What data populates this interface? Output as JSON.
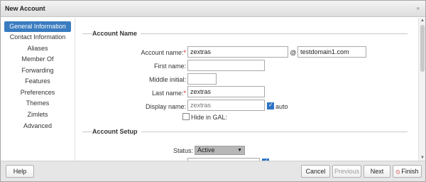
{
  "window": {
    "title": "New Account",
    "expand_glyph": "»"
  },
  "sidebar": {
    "items": [
      {
        "label": "General Information"
      },
      {
        "label": "Contact Information"
      },
      {
        "label": "Aliases"
      },
      {
        "label": "Member Of"
      },
      {
        "label": "Forwarding"
      },
      {
        "label": "Features"
      },
      {
        "label": "Preferences"
      },
      {
        "label": "Themes"
      },
      {
        "label": "Zimlets"
      },
      {
        "label": "Advanced"
      }
    ],
    "active_index": 0
  },
  "sections": {
    "account_name": "Account Name",
    "account_setup": "Account Setup"
  },
  "form": {
    "account_name": {
      "label": "Account name:",
      "required": "*",
      "value": "zextras",
      "at": "@",
      "domain": "testdomain1.com"
    },
    "first_name": {
      "label": "First name:",
      "value": ""
    },
    "middle_initial": {
      "label": "Middle initial:",
      "value": ""
    },
    "last_name": {
      "label": "Last name:",
      "required": "*",
      "value": "zextras"
    },
    "display_name": {
      "label": "Display name:",
      "value": "zextras",
      "auto_label": "auto",
      "auto_checked": true
    },
    "hide_in_gal": {
      "label": "Hide in GAL:",
      "checked": false
    },
    "status": {
      "label": "Status:",
      "value": "Active",
      "caret": "▼"
    }
  },
  "footer": {
    "help": "Help",
    "cancel": "Cancel",
    "previous": "Previous",
    "next": "Next",
    "finish": "Finish",
    "finish_icon": "⦸"
  },
  "colors": {
    "accent": "#3a7cc0",
    "required": "#d22222",
    "finish_icon": "#c41e1e"
  }
}
